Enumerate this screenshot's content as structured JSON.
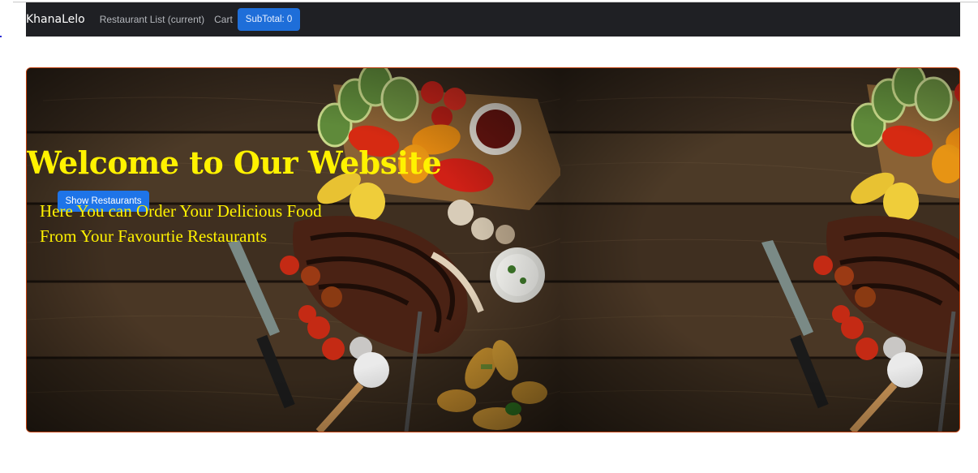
{
  "navbar": {
    "brand": "KhanaLelo",
    "links": [
      "Restaurant List (current)",
      "Cart"
    ],
    "subtotal_label": "SubTotal: 0"
  },
  "hero": {
    "title": "Welcome to Our Website",
    "button_label": "Show Restaurants",
    "subtitle_line1": "Here You can Order Your Delicious Food",
    "subtitle_line2": "From Your Favourtie Restaurants",
    "image": "grilled-steak-vegetables-on-wooden-table"
  },
  "colors": {
    "navbar_bg": "#1f2024",
    "accent_blue": "#1e6ed9",
    "hero_text": "#fff200",
    "hero_border": "#c2400e"
  }
}
